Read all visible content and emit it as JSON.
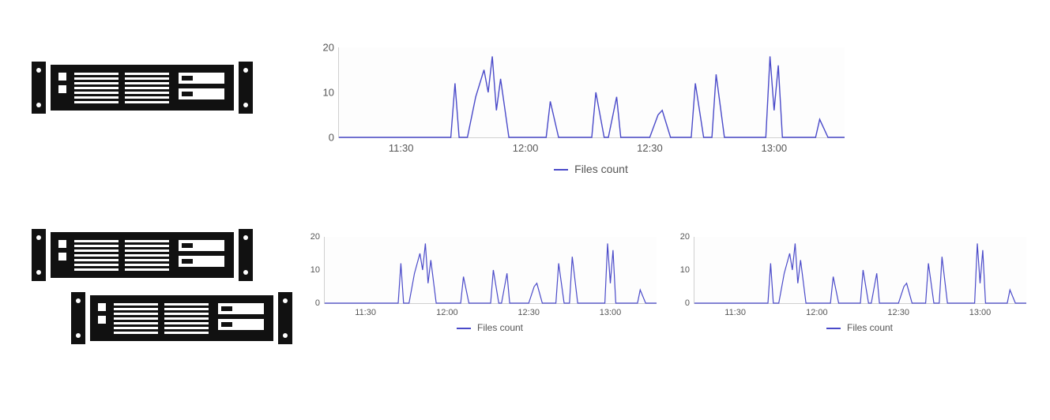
{
  "legend_label": "Files count",
  "palette": {
    "line": "#4a4ac9"
  },
  "chart_data": [
    {
      "id": "chart-top",
      "type": "line",
      "title": "",
      "xlabel": "",
      "ylabel": "",
      "ylim": [
        0,
        20
      ],
      "y_ticks": [
        0,
        10,
        20
      ],
      "xlim": [
        "11:15",
        "13:17"
      ],
      "x_ticks": [
        "11:30",
        "12:00",
        "12:30",
        "13:00"
      ],
      "series": [
        {
          "name": "Files count",
          "color": "#4a4ac9",
          "x": [
            "11:15",
            "11:42",
            "11:43",
            "11:44",
            "11:46",
            "11:48",
            "11:50",
            "11:51",
            "11:52",
            "11:53",
            "11:54",
            "11:56",
            "11:58",
            "12:02",
            "12:05",
            "12:06",
            "12:08",
            "12:14",
            "12:16",
            "12:17",
            "12:19",
            "12:20",
            "12:22",
            "12:23",
            "12:25",
            "12:30",
            "12:32",
            "12:33",
            "12:35",
            "12:40",
            "12:41",
            "12:43",
            "12:45",
            "12:46",
            "12:48",
            "12:55",
            "12:58",
            "12:59",
            "13:00",
            "13:01",
            "13:02",
            "13:04",
            "13:08",
            "13:10",
            "13:11",
            "13:13",
            "13:17"
          ],
          "values": [
            0,
            0,
            12,
            0,
            0,
            9,
            15,
            10,
            18,
            6,
            13,
            0,
            0,
            0,
            0,
            8,
            0,
            0,
            0,
            10,
            0,
            0,
            9,
            0,
            0,
            0,
            5,
            6,
            0,
            0,
            12,
            0,
            0,
            14,
            0,
            0,
            0,
            18,
            6,
            16,
            0,
            0,
            0,
            0,
            4,
            0,
            0
          ]
        }
      ]
    },
    {
      "id": "chart-bottom-left",
      "type": "line",
      "title": "",
      "xlabel": "",
      "ylabel": "",
      "ylim": [
        0,
        20
      ],
      "y_ticks": [
        0,
        10,
        20
      ],
      "xlim": [
        "11:15",
        "13:17"
      ],
      "x_ticks": [
        "11:30",
        "12:00",
        "12:30",
        "13:00"
      ],
      "series": [
        {
          "name": "Files count",
          "color": "#4a4ac9",
          "x": [
            "11:15",
            "11:42",
            "11:43",
            "11:44",
            "11:46",
            "11:48",
            "11:50",
            "11:51",
            "11:52",
            "11:53",
            "11:54",
            "11:56",
            "11:58",
            "12:02",
            "12:05",
            "12:06",
            "12:08",
            "12:14",
            "12:16",
            "12:17",
            "12:19",
            "12:20",
            "12:22",
            "12:23",
            "12:25",
            "12:30",
            "12:32",
            "12:33",
            "12:35",
            "12:40",
            "12:41",
            "12:43",
            "12:45",
            "12:46",
            "12:48",
            "12:55",
            "12:58",
            "12:59",
            "13:00",
            "13:01",
            "13:02",
            "13:04",
            "13:08",
            "13:10",
            "13:11",
            "13:13",
            "13:17"
          ],
          "values": [
            0,
            0,
            12,
            0,
            0,
            9,
            15,
            10,
            18,
            6,
            13,
            0,
            0,
            0,
            0,
            8,
            0,
            0,
            0,
            10,
            0,
            0,
            9,
            0,
            0,
            0,
            5,
            6,
            0,
            0,
            12,
            0,
            0,
            14,
            0,
            0,
            0,
            18,
            6,
            16,
            0,
            0,
            0,
            0,
            4,
            0,
            0
          ]
        }
      ]
    },
    {
      "id": "chart-bottom-right",
      "type": "line",
      "title": "",
      "xlabel": "",
      "ylabel": "",
      "ylim": [
        0,
        20
      ],
      "y_ticks": [
        0,
        10,
        20
      ],
      "xlim": [
        "11:15",
        "13:17"
      ],
      "x_ticks": [
        "11:30",
        "12:00",
        "12:30",
        "13:00"
      ],
      "series": [
        {
          "name": "Files count",
          "color": "#4a4ac9",
          "x": [
            "11:15",
            "11:42",
            "11:43",
            "11:44",
            "11:46",
            "11:48",
            "11:50",
            "11:51",
            "11:52",
            "11:53",
            "11:54",
            "11:56",
            "11:58",
            "12:02",
            "12:05",
            "12:06",
            "12:08",
            "12:14",
            "12:16",
            "12:17",
            "12:19",
            "12:20",
            "12:22",
            "12:23",
            "12:25",
            "12:30",
            "12:32",
            "12:33",
            "12:35",
            "12:40",
            "12:41",
            "12:43",
            "12:45",
            "12:46",
            "12:48",
            "12:55",
            "12:58",
            "12:59",
            "13:00",
            "13:01",
            "13:02",
            "13:04",
            "13:08",
            "13:10",
            "13:11",
            "13:13",
            "13:17"
          ],
          "values": [
            0,
            0,
            12,
            0,
            0,
            9,
            15,
            10,
            18,
            6,
            13,
            0,
            0,
            0,
            0,
            8,
            0,
            0,
            0,
            10,
            0,
            0,
            9,
            0,
            0,
            0,
            5,
            6,
            0,
            0,
            12,
            0,
            0,
            14,
            0,
            0,
            0,
            18,
            6,
            16,
            0,
            0,
            0,
            0,
            4,
            0,
            0
          ]
        }
      ]
    }
  ]
}
